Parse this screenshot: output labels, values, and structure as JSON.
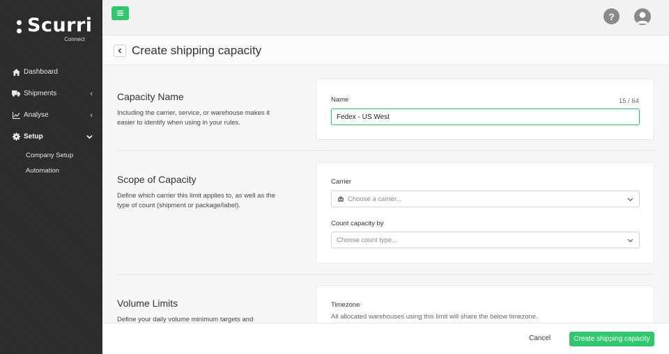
{
  "brand": {
    "name": "Scurri",
    "tagline": "Connect",
    "accent": "#2dc96a"
  },
  "sidebar": {
    "items": [
      {
        "label": "Dashboard",
        "icon": "home-icon",
        "has_chevron": false
      },
      {
        "label": "Shipments",
        "icon": "truck-icon",
        "chevron": "‹"
      },
      {
        "label": "Analyse",
        "icon": "chart-icon",
        "chevron": "‹"
      },
      {
        "label": "Setup",
        "icon": "gear-icon",
        "chevron": "⌄",
        "active": true
      }
    ],
    "sub_items": [
      "Company Setup",
      "Automation"
    ]
  },
  "topbar": {
    "menu_icon": "hamburger-icon",
    "help_label": "?",
    "user_icon": "user-icon"
  },
  "page": {
    "title": "Create shipping capacity"
  },
  "sections": {
    "capacity_name": {
      "title": "Capacity Name",
      "description": "Including the carrier, service, or warehouse makes it easier to identify when using in your rules.",
      "field_label": "Name",
      "counter": "15 / 64",
      "value": "Fedex - US West"
    },
    "scope": {
      "title": "Scope of Capacity",
      "description": "Define which carrier this limit applies to, as well as the type of count (shipment or package/label).",
      "carrier_label": "Carrier",
      "carrier_placeholder": "Choose a carrier...",
      "count_label": "Count capacity by",
      "count_placeholder": "Choose count type..."
    },
    "volume": {
      "title": "Volume Limits",
      "description": "Define your daily volume minimum targets and",
      "timezone_label": "Timezone",
      "timezone_hint": "All allocated warehouses using this limit will share the below timezone."
    }
  },
  "footer": {
    "cancel_label": "Cancel",
    "submit_label": "Create shipping capacity"
  }
}
